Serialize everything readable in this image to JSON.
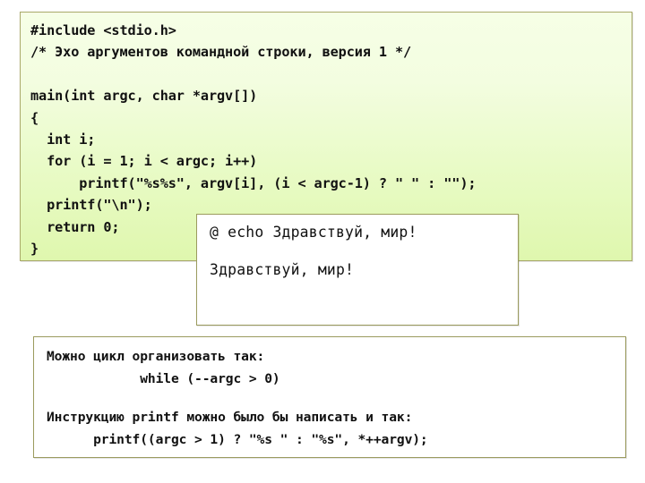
{
  "slide": {
    "title_text": "",
    "background_color": "#ffffff"
  },
  "code_panel": {
    "name": "c-source-listing",
    "background_top_color": "#f6ffe6",
    "background_bottom_color": "#dff7ae",
    "border_color": "#a9a96a",
    "lines": [
      "#include <stdio.h>",
      "/* Эхо аргументов командной строки, версия 1 */",
      "",
      "main(int argc, char *argv[])",
      "{",
      "  int i;",
      "  for (i = 1; i < argc; i++)",
      "      printf(\"%s%s\", argv[i], (i < argc-1) ? \" \" : \"\");",
      "  printf(\"\\n\");",
      "  return 0;",
      "}"
    ]
  },
  "output_panel": {
    "name": "console-output",
    "background_color": "#ffffff",
    "border_color": "#9b9b5e",
    "command_line": "@ echo Здравствуй, мир!",
    "result_line": "Здравствуй, мир!"
  },
  "notes_panel": {
    "name": "explanatory-notes",
    "background_color": "#ffffff",
    "border_color": "#9b9b5e",
    "lines": [
      "Можно цикл организовать так:",
      "            while (--argc > 0)",
      "",
      "Инструкцию printf можно было бы написать и так:",
      "      printf((argc > 1) ? \"%s \" : \"%s\", *++argv);"
    ]
  }
}
